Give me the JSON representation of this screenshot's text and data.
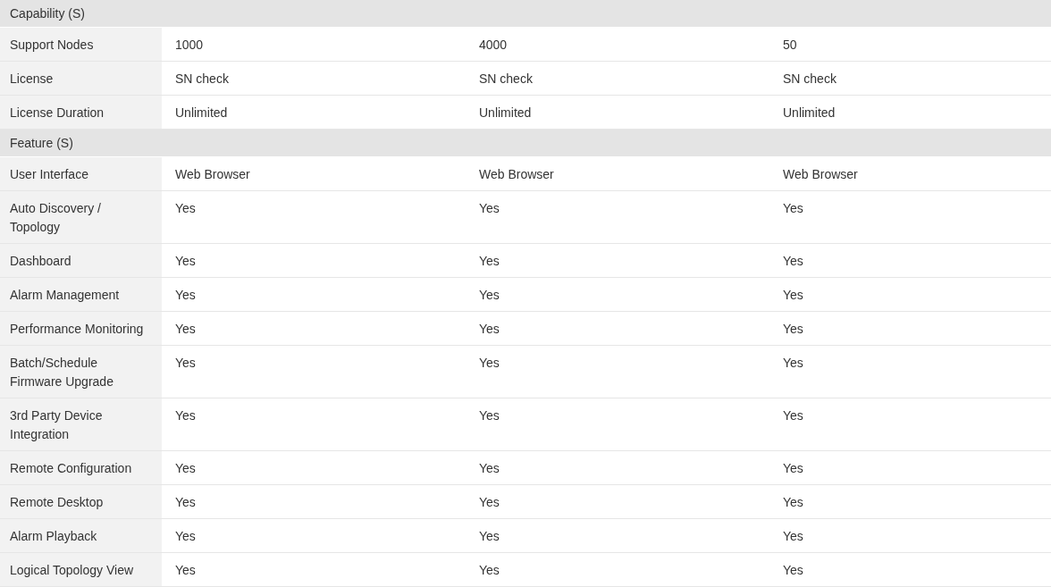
{
  "sections": [
    {
      "title": "Capability (S)",
      "rows": [
        {
          "label": "Support Nodes",
          "values": [
            "1000",
            "4000",
            "50"
          ]
        },
        {
          "label": "License",
          "values": [
            "SN check",
            "SN check",
            "SN check"
          ]
        },
        {
          "label": "License Duration",
          "values": [
            "Unlimited",
            "Unlimited",
            "Unlimited"
          ]
        }
      ]
    },
    {
      "title": "Feature (S)",
      "rows": [
        {
          "label": "User Interface",
          "values": [
            "Web Browser",
            "Web Browser",
            "Web Browser"
          ]
        },
        {
          "label": "Auto Discovery / Topology",
          "values": [
            "Yes",
            "Yes",
            "Yes"
          ]
        },
        {
          "label": "Dashboard",
          "values": [
            "Yes",
            "Yes",
            "Yes"
          ]
        },
        {
          "label": "Alarm Management",
          "values": [
            "Yes",
            "Yes",
            "Yes"
          ]
        },
        {
          "label": "Performance Monitoring",
          "values": [
            "Yes",
            "Yes",
            "Yes"
          ]
        },
        {
          "label": "Batch/Schedule Firmware Upgrade",
          "values": [
            "Yes",
            "Yes",
            "Yes"
          ]
        },
        {
          "label": "3rd Party Device Integration",
          "values": [
            "Yes",
            "Yes",
            "Yes"
          ]
        },
        {
          "label": "Remote Configuration",
          "values": [
            "Yes",
            "Yes",
            "Yes"
          ]
        },
        {
          "label": "Remote Desktop",
          "values": [
            "Yes",
            "Yes",
            "Yes"
          ]
        },
        {
          "label": "Alarm Playback",
          "values": [
            "Yes",
            "Yes",
            "Yes"
          ]
        },
        {
          "label": "Logical Topology View",
          "values": [
            "Yes",
            "Yes",
            "Yes"
          ]
        }
      ]
    }
  ]
}
